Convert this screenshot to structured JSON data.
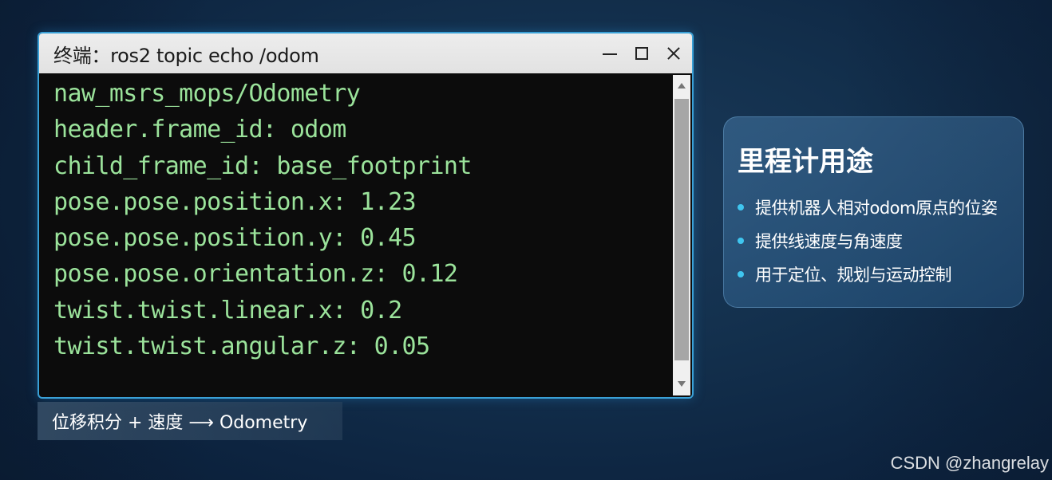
{
  "terminal": {
    "title": "终端：ros2 topic echo /odom",
    "lines": [
      "naw_msrs_mops/Odometry",
      "header.frame_id: odom",
      "child_frame_id: base_footprint",
      "pose.pose.position.x: 1.23",
      "pose.pose.position.y: 0.45",
      "pose.pose.orientation.z: 0.12",
      "twist.twist.linear.x: 0.2",
      "twist.twist.angular.z: 0.05"
    ],
    "controls": {
      "minimize": "minimize-icon",
      "maximize": "maximize-icon",
      "close": "close-icon"
    }
  },
  "caption": {
    "text": "位移积分 + 速度 ⟶ Odometry"
  },
  "panel": {
    "title": "里程计用途",
    "items": [
      "提供机器人相对odom原点的位姿",
      "提供线速度与角速度",
      "用于定位、规划与运动控制"
    ],
    "bullet_color": "#3fc6f0"
  },
  "watermark": "CSDN @zhangrelay",
  "colors": {
    "terminal_text": "#9be39b",
    "window_border": "#3aa0d6",
    "background": "#13304d"
  }
}
